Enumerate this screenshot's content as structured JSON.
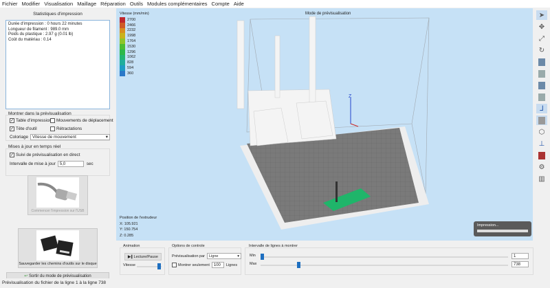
{
  "menu": [
    "Fichier",
    "Modifier",
    "Visualisation",
    "Maillage",
    "Réparation",
    "Outils",
    "Modules complémentaires",
    "Compte",
    "Aide"
  ],
  "stats": {
    "title": "Statistiques d'impression",
    "lines": [
      "Durée d'impression : 0 hours 22 minutes",
      "Longueur de filament : 989.0 mm",
      "Poids du plastique : 2.97 g (0.01 lb)",
      "Coût du matériau : 0.14"
    ]
  },
  "preview": {
    "title": "Montrer dans la prévisualisation",
    "table": "Table d'impression",
    "moves": "Mouvements de déplacement",
    "tool": "Tête d'outil",
    "retract": "Rétractations",
    "coloring_label": "Coloriage",
    "coloring_value": "Vitesse de mouvement"
  },
  "realtime": {
    "title": "Mises à jour en temps réel",
    "follow": "Suivi de prévisualisation en direct",
    "interval_label": "Intervalle de mise à jour",
    "interval_value": "5,0",
    "unit": "sec"
  },
  "buttons": {
    "usb": "Commencer l'impression sur l'USB",
    "save": "Sauvegarder les chemins d'outils sur le disque",
    "exit": "Sortir du mode de prévisualisation"
  },
  "viewport": {
    "mode": "Mode de prévisualisation",
    "axis_z": "Z",
    "extruder_title": "Position de l'extrudeur",
    "x": "X: 105.921",
    "y": "Y: 150.754",
    "z": "Z: 0.285",
    "print_popup": "Impression..."
  },
  "legend": {
    "title": "Vitesse (mm/min)",
    "items": [
      {
        "v": "2700",
        "c": "#c0272d"
      },
      {
        "v": "2466",
        "c": "#cf5a26"
      },
      {
        "v": "2232",
        "c": "#d98e1f"
      },
      {
        "v": "1998",
        "c": "#c9b21c"
      },
      {
        "v": "1764",
        "c": "#8fc52a"
      },
      {
        "v": "1530",
        "c": "#4dbd33"
      },
      {
        "v": "1296",
        "c": "#2db84a"
      },
      {
        "v": "1062",
        "c": "#22b573"
      },
      {
        "v": "828",
        "c": "#1fae9c"
      },
      {
        "v": "594",
        "c": "#1d9cc4"
      },
      {
        "v": "360",
        "c": "#2a78c8"
      }
    ]
  },
  "animation": {
    "title": "Animation",
    "play": "Lecture/Pause",
    "speed": "Vitesse"
  },
  "control": {
    "title": "Options de controle",
    "preview_by": "Prévisualisation par",
    "preview_by_value": "Ligne",
    "show_only": "Montrer seulement",
    "show_only_value": "100",
    "lines": "Lignes"
  },
  "range": {
    "title": "Intervalle de lignes à montrer",
    "min_label": "Min",
    "max_label": "Max",
    "min_value": "1",
    "max_value": "738"
  },
  "status": "Prévisualisation du fichier de la ligne 1 à la ligne 738"
}
